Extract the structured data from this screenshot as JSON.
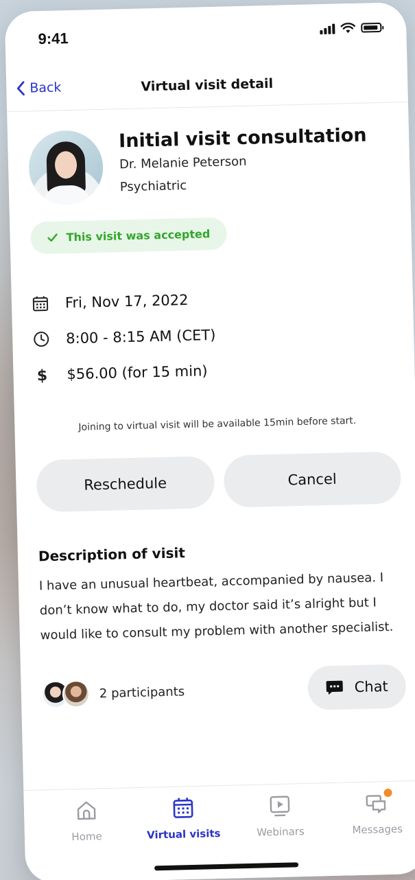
{
  "status_bar": {
    "time": "9:41"
  },
  "nav": {
    "back_label": "Back",
    "title": "Virtual visit detail"
  },
  "visit": {
    "title": "Initial visit consultation",
    "doctor": "Dr. Melanie Peterson",
    "specialty": "Psychiatric",
    "status": "This visit was accepted",
    "date": "Fri, Nov 17, 2022",
    "time": "8:00 - 8:15 AM (CET)",
    "price": "$56.00  (for 15 min)",
    "join_note": "Joining to virtual visit will be available 15min before start."
  },
  "actions": {
    "reschedule_label": "Reschedule",
    "cancel_label": "Cancel"
  },
  "description": {
    "heading": "Description of visit",
    "text": "I have an unusual heartbeat, accompanied by nausea. I don’t know what to do, my doctor said it’s alright but I would like to consult my problem with another specialist."
  },
  "participants": {
    "label": "2 participants",
    "chat_label": "Chat"
  },
  "tab_bar": {
    "items": [
      {
        "label": "Home",
        "icon": "home-icon"
      },
      {
        "label": "Virtual visits",
        "icon": "calendar-icon"
      },
      {
        "label": "Webinars",
        "icon": "play-icon"
      },
      {
        "label": "Messages",
        "icon": "messages-icon"
      }
    ]
  },
  "colors": {
    "accent": "#2a34c8",
    "success": "#34a52c",
    "success_bg": "#e7f6e8",
    "notification": "#f28c28"
  }
}
